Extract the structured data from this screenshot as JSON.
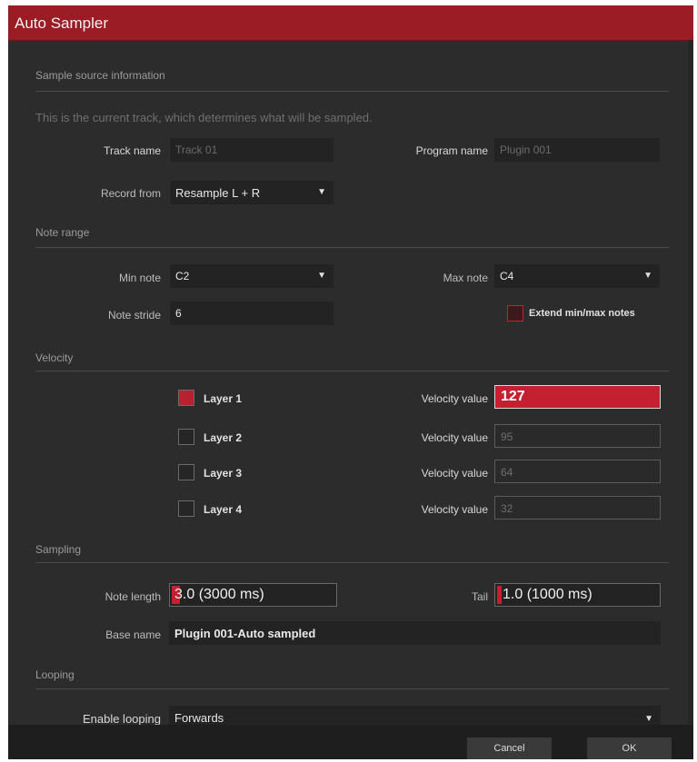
{
  "window": {
    "title": "Auto Sampler"
  },
  "sections": {
    "source": "Sample source information",
    "note_range": "Note range",
    "velocity": "Velocity",
    "sampling": "Sampling",
    "looping": "Looping"
  },
  "source": {
    "info": "This is the current track, which determines what will be sampled.",
    "track_name_label": "Track name",
    "track_name_value": "Track 01",
    "program_name_label": "Program name",
    "program_name_value": "Plugin 001",
    "record_from_label": "Record from",
    "record_from_value": "Resample L + R"
  },
  "note_range": {
    "min_note_label": "Min note",
    "min_note_value": "C2",
    "max_note_label": "Max note",
    "max_note_value": "C4",
    "note_stride_label": "Note stride",
    "note_stride_value": "6",
    "extend_label": "Extend min/max notes",
    "extend_checked": false
  },
  "velocity": {
    "layers": [
      {
        "label": "Layer 1",
        "checked": true,
        "vel_label": "Velocity value",
        "value": "127",
        "active": true
      },
      {
        "label": "Layer 2",
        "checked": false,
        "vel_label": "Velocity value",
        "value": "95",
        "active": false
      },
      {
        "label": "Layer 3",
        "checked": false,
        "vel_label": "Velocity value",
        "value": "64",
        "active": false
      },
      {
        "label": "Layer 4",
        "checked": false,
        "vel_label": "Velocity value",
        "value": "32",
        "active": false
      }
    ]
  },
  "sampling": {
    "note_length_label": "Note length",
    "note_length_value": "3.0 (3000 ms)",
    "tail_label": "Tail",
    "tail_value": "1.0 (1000 ms)",
    "base_name_label": "Base name",
    "base_name_value": "Plugin 001-Auto sampled"
  },
  "looping": {
    "enable_label": "Enable looping",
    "enable_value": "Forwards"
  },
  "footer": {
    "cancel": "Cancel",
    "ok": "OK"
  },
  "icons": {
    "dropdown": "chevron-down-icon",
    "checkbox": "checkbox-icon"
  },
  "colors": {
    "accent": "#c42032",
    "titlebar": "#9b1c24",
    "background": "#2c2c2c"
  }
}
